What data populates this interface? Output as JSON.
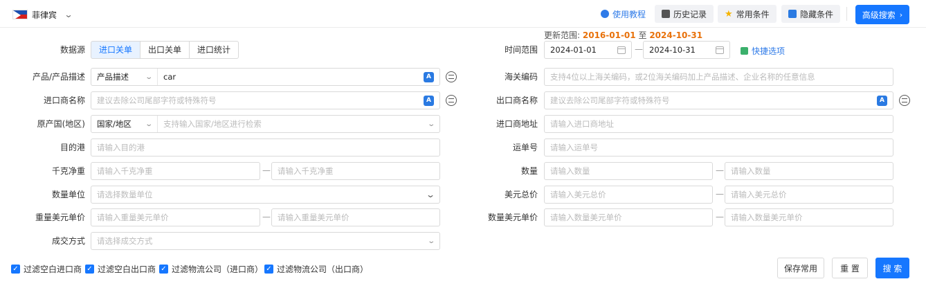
{
  "header": {
    "country": "菲律宾",
    "tutorial": "使用教程",
    "history": "历史记录",
    "common_conditions": "常用条件",
    "hide_conditions": "隐藏条件",
    "advanced_search": "高级搜索",
    "accent_color": "#1677ff"
  },
  "update_range": {
    "prefix": "更新范围:",
    "start": "2016-01-01",
    "to": "至",
    "end": "2024-10-31"
  },
  "data_source": {
    "label": "数据源",
    "options": [
      "进口关单",
      "出口关单",
      "进口统计"
    ],
    "selected": "进口关单"
  },
  "time_range": {
    "label": "时间范围",
    "start": "2024-01-01",
    "end": "2024-10-31",
    "quick": "快捷选项"
  },
  "left_fields": {
    "product": {
      "label": "产品/产品描述",
      "type": "产品描述",
      "value": "car"
    },
    "importer": {
      "label": "进口商名称",
      "placeholder": "建议去除公司尾部字符或特殊符号"
    },
    "origin": {
      "label": "原产国(地区)",
      "type": "国家/地区",
      "placeholder": "支持输入国家/地区进行检索"
    },
    "port": {
      "label": "目的港",
      "placeholder": "请输入目的港"
    },
    "net_weight": {
      "label": "千克净重",
      "placeholder_min": "请输入千克净重",
      "placeholder_max": "请输入千克净重"
    },
    "qty_unit": {
      "label": "数量单位",
      "placeholder": "请选择数量单位"
    },
    "weight_price": {
      "label": "重量美元单价",
      "placeholder_min": "请输入重量美元单价",
      "placeholder_max": "请输入重量美元单价"
    },
    "deal_mode": {
      "label": "成交方式",
      "placeholder": "请选择成交方式"
    }
  },
  "right_fields": {
    "hs_code": {
      "label": "海关编码",
      "placeholder": "支持4位以上海关编码，或2位海关编码加上产品描述、企业名称的任意信息"
    },
    "exporter": {
      "label": "出口商名称",
      "placeholder": "建议去除公司尾部字符或特殊符号"
    },
    "importer_addr": {
      "label": "进口商地址",
      "placeholder": "请输入进口商地址"
    },
    "waybill": {
      "label": "运单号",
      "placeholder": "请输入运单号"
    },
    "quantity": {
      "label": "数量",
      "placeholder_min": "请输入数量",
      "placeholder_max": "请输入数量"
    },
    "usd_total": {
      "label": "美元总价",
      "placeholder_min": "请输入美元总价",
      "placeholder_max": "请输入美元总价"
    },
    "qty_price": {
      "label": "数量美元单价",
      "placeholder_min": "请输入数量美元单价",
      "placeholder_max": "请输入数量美元单价"
    }
  },
  "dash": "—",
  "filters": [
    "过滤空白进口商",
    "过滤空白出口商",
    "过滤物流公司（进口商）",
    "过滤物流公司（出口商）"
  ],
  "footer": {
    "save": "保存常用",
    "reset": "重 置",
    "search": "搜 索"
  }
}
